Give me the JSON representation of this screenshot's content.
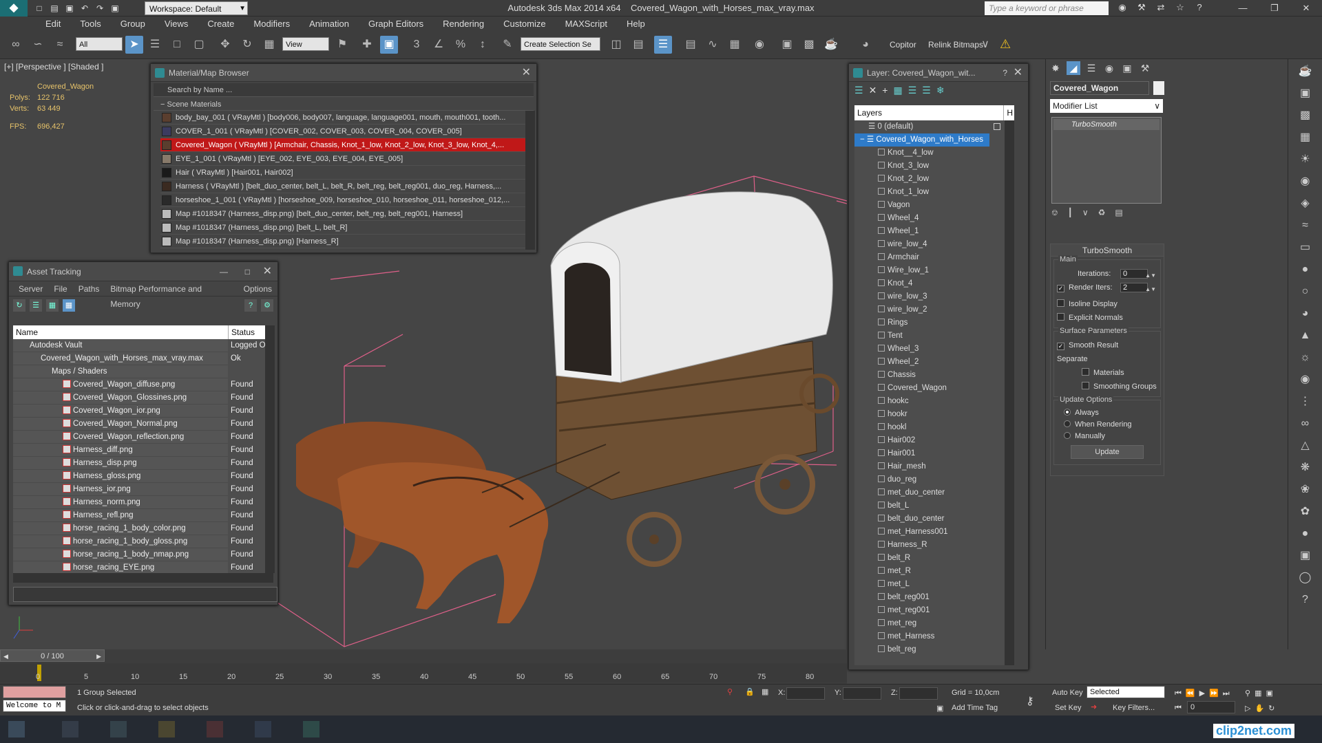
{
  "app": {
    "title": "Autodesk 3ds Max  2014 x64",
    "filename": "Covered_Wagon_with_Horses_max_vray.max",
    "workspace": "Workspace: Default",
    "search_placeholder": "Type a keyword or phrase"
  },
  "menu": [
    "Edit",
    "Tools",
    "Group",
    "Views",
    "Create",
    "Modifiers",
    "Animation",
    "Graph Editors",
    "Rendering",
    "Customize",
    "MAXScript",
    "Help"
  ],
  "toolbar": {
    "filter": "All",
    "ref_coord": "View",
    "selection_set": "Create Selection Se",
    "copitor": "Copitor",
    "relink": "Relink Bitmaps"
  },
  "viewport": {
    "label": "[+] [Perspective ] [Shaded ]",
    "object_name": "Covered_Wagon",
    "polys_label": "Polys:",
    "polys": "122 716",
    "verts_label": "Verts:",
    "verts": "63 449",
    "fps_label": "FPS:",
    "fps": "696,427"
  },
  "material_browser": {
    "title": "Material/Map Browser",
    "search": "Search by Name ...",
    "section": "Scene Materials",
    "rows": [
      "body_bay_001  ( VRayMtl )  [body006, body007, language, language001, mouth, mouth001, tooth...",
      "COVER_1_001  ( VRayMtl )  [COVER_002, COVER_003, COVER_004, COVER_005]",
      "Covered_Wagon  ( VRayMtl )  [Armchair, Chassis, Knot_1_low, Knot_2_low, Knot_3_low, Knot_4,...",
      "EYE_1_001  ( VRayMtl )  [EYE_002, EYE_003, EYE_004, EYE_005]",
      "Hair  ( VRayMtl )  [Hair001, Hair002]",
      "Harness  ( VRayMtl )  [belt_duo_center, belt_L, belt_R, belt_reg, belt_reg001, duo_reg, Harness,...",
      "horseshoe_1_001  ( VRayMtl )  [horseshoe_009, horseshoe_010, horseshoe_011, horseshoe_012,...",
      "Map #1018347 (Harness_disp.png)  [belt_duo_center, belt_reg, belt_reg001, Harness]",
      "Map #1018347 (Harness_disp.png)  [belt_L, belt_R]",
      "Map #1018347 (Harness_disp.png)  [Harness_R]"
    ]
  },
  "asset_tracking": {
    "title": "Asset Tracking",
    "menu": [
      "Server",
      "File",
      "Paths",
      "Bitmap Performance and Memory",
      "Options"
    ],
    "col_name": "Name",
    "col_status": "Status",
    "rows": [
      {
        "name": "Autodesk Vault",
        "status": "Logged Ou"
      },
      {
        "name": "Covered_Wagon_with_Horses_max_vray.max",
        "status": "Ok"
      },
      {
        "name": "Maps / Shaders",
        "status": ""
      },
      {
        "name": "Covered_Wagon_diffuse.png",
        "status": "Found"
      },
      {
        "name": "Covered_Wagon_Glossines.png",
        "status": "Found"
      },
      {
        "name": "Covered_Wagon_ior.png",
        "status": "Found"
      },
      {
        "name": "Covered_Wagon_Normal.png",
        "status": "Found"
      },
      {
        "name": "Covered_Wagon_reflection.png",
        "status": "Found"
      },
      {
        "name": "Harness_diff.png",
        "status": "Found"
      },
      {
        "name": "Harness_disp.png",
        "status": "Found"
      },
      {
        "name": "Harness_gloss.png",
        "status": "Found"
      },
      {
        "name": "Harness_ior.png",
        "status": "Found"
      },
      {
        "name": "Harness_norm.png",
        "status": "Found"
      },
      {
        "name": "Harness_refl.png",
        "status": "Found"
      },
      {
        "name": "horse_racing_1_body_color.png",
        "status": "Found"
      },
      {
        "name": "horse_racing_1_body_gloss.png",
        "status": "Found"
      },
      {
        "name": "horse_racing_1_body_nmap.png",
        "status": "Found"
      },
      {
        "name": "horse_racing_EYE.png",
        "status": "Found"
      }
    ]
  },
  "layers": {
    "title": "Layer: Covered_Wagon_wit...",
    "help": "?",
    "col_layers": "Layers",
    "col_h": "H",
    "items": [
      "0 (default)",
      "Covered_Wagon_with_Horses",
      "Knot__4_low",
      "Knot_3_low",
      "Knot_2_low",
      "Knot_1_low",
      "Vagon",
      "Wheel_4",
      "Wheel_1",
      "wire_low_4",
      "Armchair",
      "Wire_low_1",
      "Knot_4",
      "wire_low_3",
      "wire_low_2",
      "Rings",
      "Tent",
      "Wheel_3",
      "Wheel_2",
      "Chassis",
      "Covered_Wagon",
      "hookc",
      "hookr",
      "hookl",
      "Hair002",
      "Hair001",
      "Hair_mesh",
      "duo_reg",
      "met_duo_center",
      "belt_L",
      "belt_duo_center",
      "met_Harness001",
      "Harness_R",
      "belt_R",
      "met_R",
      "met_L",
      "belt_reg001",
      "met_reg001",
      "met_reg",
      "met_Harness",
      "belt_reg"
    ]
  },
  "command_panel": {
    "object_name": "Covered_Wagon",
    "modifier_list": "Modifier List",
    "stack_item": "TurboSmooth",
    "rollout_title": "TurboSmooth",
    "main": "Main",
    "iterations_label": "Iterations:",
    "iterations": "0",
    "render_iters_label": "Render Iters:",
    "render_iters": "2",
    "isoline": "Isoline Display",
    "explicit": "Explicit Normals",
    "surface": "Surface Parameters",
    "smooth": "Smooth Result",
    "separate": "Separate",
    "materials": "Materials",
    "smoothing_groups": "Smoothing Groups",
    "update_options": "Update Options",
    "always": "Always",
    "when_rendering": "When Rendering",
    "manually": "Manually",
    "update": "Update"
  },
  "timeline": {
    "frame": "0 / 100",
    "ticks": [
      "0",
      "5",
      "10",
      "15",
      "20",
      "25",
      "30",
      "35",
      "40",
      "45",
      "50",
      "55",
      "60",
      "65",
      "70",
      "75",
      "80"
    ]
  },
  "status": {
    "selected": "1 Group Selected",
    "prompt": "Click or click-and-drag to select objects",
    "welcome": "Welcome to M",
    "x": "X:",
    "y": "Y:",
    "z": "Z:",
    "grid": "Grid = 10,0cm",
    "add_time_tag": "Add Time Tag",
    "auto_key": "Auto Key",
    "set_key": "Set Key",
    "key_mode": "Selected",
    "key_filters": "Key Filters...",
    "frame_value": "0"
  },
  "watermark": "clip2net.com"
}
